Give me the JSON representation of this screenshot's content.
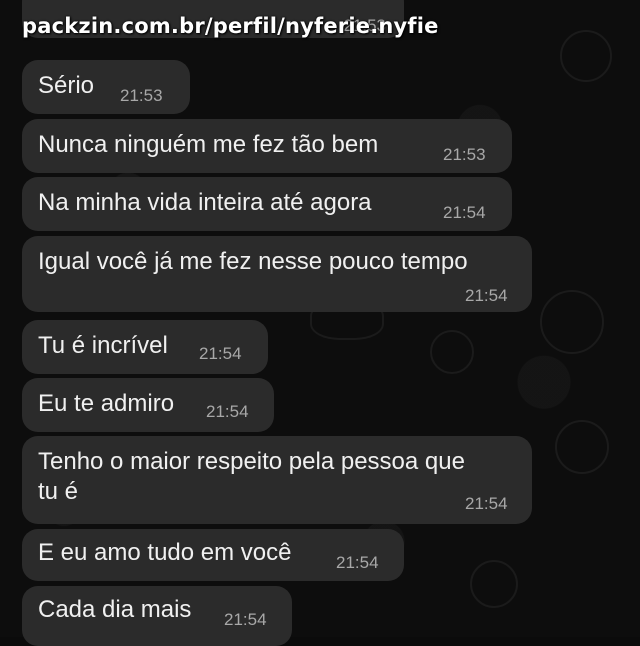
{
  "watermark": "packzin.com.br/perfil/nyferie.nyfie",
  "messages": [
    {
      "text": "",
      "time": "21:53"
    },
    {
      "text": "Sério",
      "time": "21:53"
    },
    {
      "text": "Nunca ninguém me fez tão bem",
      "time": "21:53"
    },
    {
      "text": "Na minha vida inteira até agora",
      "time": "21:54"
    },
    {
      "text": "Igual você já me fez nesse pouco tempo",
      "time": "21:54"
    },
    {
      "text": "Tu é incrível",
      "time": "21:54"
    },
    {
      "text": "Eu te admiro",
      "time": "21:54"
    },
    {
      "text": "Tenho o maior respeito pela pessoa que\ntu é",
      "time": "21:54"
    },
    {
      "text": "E eu amo tudo em você",
      "time": "21:54"
    },
    {
      "text": "Cada dia mais",
      "time": "21:54"
    }
  ]
}
